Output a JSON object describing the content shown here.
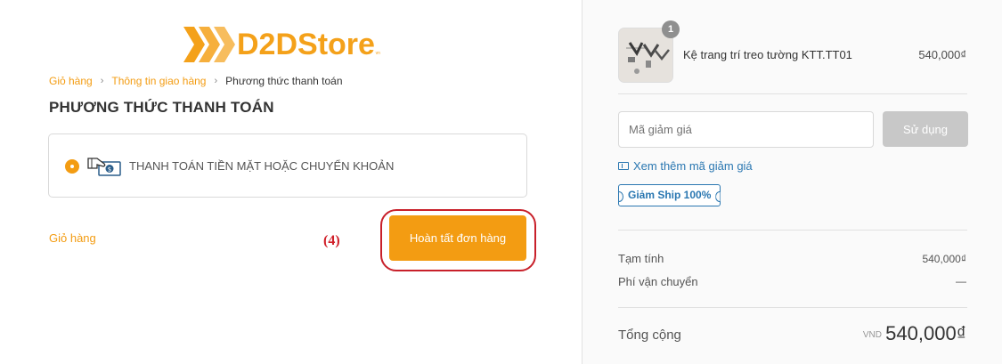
{
  "brand": {
    "logo_text": "D2DStore",
    "logo_sub": "vn",
    "color": "#f4a11a"
  },
  "breadcrumb": {
    "items": [
      "Giỏ hàng",
      "Thông tin giao hàng",
      "Phương thức thanh toán"
    ],
    "separator": "›"
  },
  "payment": {
    "section_title": "PHƯƠNG THỨC THANH TOÁN",
    "methods": [
      {
        "label": "THANH TOÁN TIỀN MẶT HOẶC CHUYỂN KHOẢN",
        "selected": true,
        "icon": "cash-hand-icon"
      }
    ]
  },
  "footer_actions": {
    "back_link": "Giỏ hàng",
    "step_annotation": "(4)",
    "complete_button": "Hoàn tất đơn hàng",
    "accent_color": "#f39c12",
    "highlight_color": "#c8202a"
  },
  "order": {
    "product": {
      "quantity": "1",
      "name": "Kệ trang trí treo tường KTT.TT01",
      "price": "540,000₫"
    },
    "discount": {
      "placeholder": "Mã giảm giá",
      "apply_button": "Sử dụng",
      "more_link": "Xem thêm mã giảm giá",
      "coupon_tag": "Giảm Ship 100%",
      "link_color": "#2a77b1"
    },
    "summary": {
      "subtotal_label": "Tạm tính",
      "subtotal_value": "540,000₫",
      "shipping_label": "Phí vận chuyển",
      "shipping_value": "—"
    },
    "total": {
      "label": "Tổng cộng",
      "currency": "VND",
      "value": "540,000₫"
    }
  }
}
